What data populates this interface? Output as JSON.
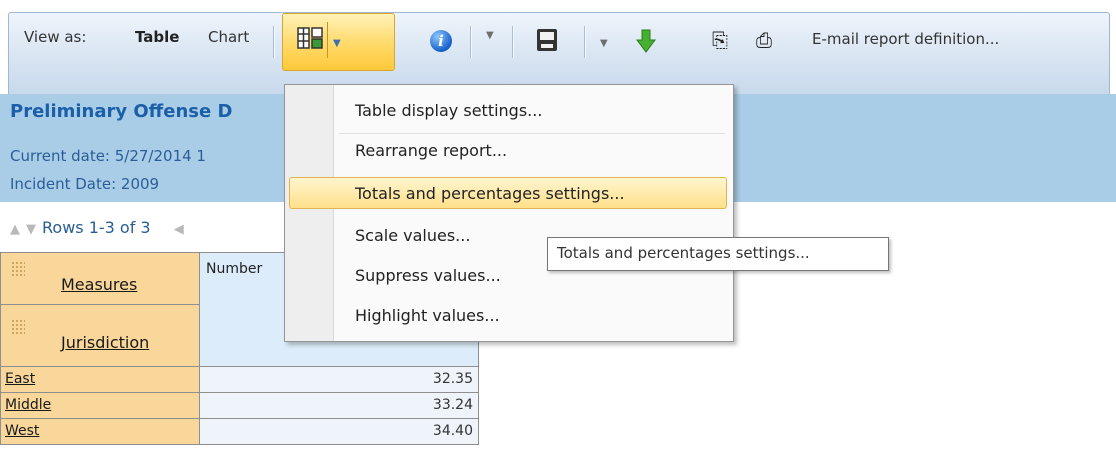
{
  "toolbar": {
    "view_as_label": "View as:",
    "table_label": "Table",
    "chart_label": "Chart",
    "email_label": "E-mail report definition...",
    "icons": [
      "table-settings-icon",
      "chevron-down-icon",
      "info-icon",
      "save-icon",
      "download-arrow-icon",
      "export-icon",
      "print-preview-icon"
    ],
    "active_button_color": "#ffd968"
  },
  "report": {
    "title": "Preliminary Offense D",
    "current_date": "Current date: 5/27/2014 1",
    "incident_date": "Incident Date: 2009",
    "band_color": "#a9cde6"
  },
  "pager": {
    "rows_text": "Rows 1-3 of 3"
  },
  "table": {
    "dim_headers": [
      "Measures",
      "Jurisdiction"
    ],
    "column_header": "Number",
    "rows": [
      {
        "label": "East",
        "value": "32.35"
      },
      {
        "label": "Middle",
        "value": "33.24"
      },
      {
        "label": "West",
        "value": "34.40"
      }
    ]
  },
  "menu": {
    "items": [
      "Table display settings...",
      "Rearrange report...",
      "Totals and percentages settings...",
      "Scale values...",
      "Suppress values...",
      "Highlight values..."
    ],
    "highlighted_index": 2
  },
  "tooltip": {
    "text": "Totals and percentages settings..."
  }
}
